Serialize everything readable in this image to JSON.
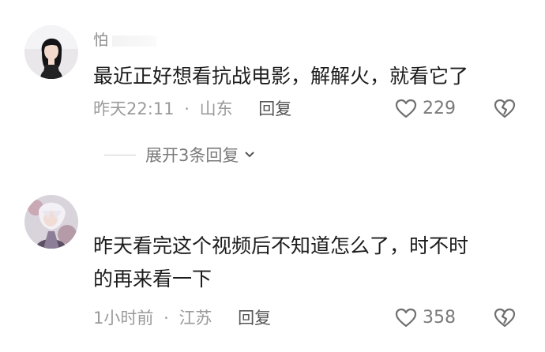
{
  "comments": [
    {
      "username": "怕",
      "text": "最近正好想看抗战电影，解解火，就看它了",
      "time": "昨天22:11",
      "location": "山东",
      "reply_label": "回复",
      "likes": "229",
      "expand_label": "展开3条回复",
      "avatar_icon": "user-avatar-woman"
    },
    {
      "username": "",
      "text_lines": [
        "昨天看完这个视频后不知道怎么了，时不时",
        "的再来看一下"
      ],
      "time": "1小时前",
      "location": "江苏",
      "reply_label": "回复",
      "likes": "358",
      "avatar_icon": "user-avatar-anime"
    }
  ],
  "separator": "·",
  "icons": {
    "like": "heart-outline-icon",
    "dislike": "broken-heart-icon"
  },
  "colors": {
    "text": "#1c1c1c",
    "meta": "#9a9a9a",
    "icon": "#6f6f6f"
  }
}
